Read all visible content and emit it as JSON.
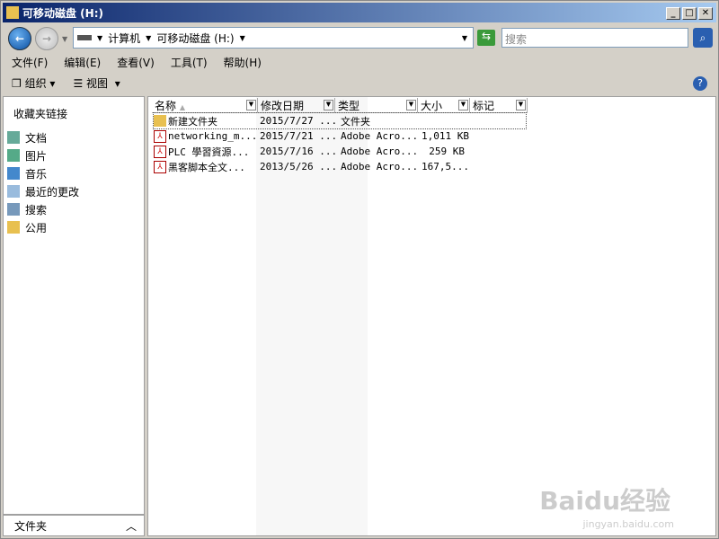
{
  "title": "可移动磁盘 (H:)",
  "address": {
    "crumbs": [
      "计算机",
      "可移动磁盘 (H:)"
    ]
  },
  "search": {
    "placeholder": "搜索"
  },
  "menu": [
    "文件(F)",
    "编辑(E)",
    "查看(V)",
    "工具(T)",
    "帮助(H)"
  ],
  "toolbar": {
    "organize": "组织",
    "views": "视图"
  },
  "sidebar": {
    "heading": "收藏夹链接",
    "items": [
      "文档",
      "图片",
      "音乐",
      "最近的更改",
      "搜索",
      "公用"
    ],
    "folders": "文件夹"
  },
  "columns": [
    "名称",
    "修改日期",
    "类型",
    "大小",
    "标记"
  ],
  "files": [
    {
      "name": "新建文件夹",
      "date": "2015/7/27 ...",
      "type": "文件夹",
      "size": "",
      "icon": "folder"
    },
    {
      "name": "networking_m...",
      "date": "2015/7/21 ...",
      "type": "Adobe Acro...",
      "size": "1,011 KB",
      "icon": "pdf"
    },
    {
      "name": "PLC 學習資源...",
      "date": "2015/7/16 ...",
      "type": "Adobe Acro...",
      "size": "259 KB",
      "icon": "pdf"
    },
    {
      "name": "黑客脚本全文...",
      "date": "2013/5/26 ...",
      "type": "Adobe Acro...",
      "size": "167,5...",
      "icon": "pdf"
    }
  ],
  "watermark": {
    "brand": "Baidu经验",
    "url": "jingyan.baidu.com"
  }
}
